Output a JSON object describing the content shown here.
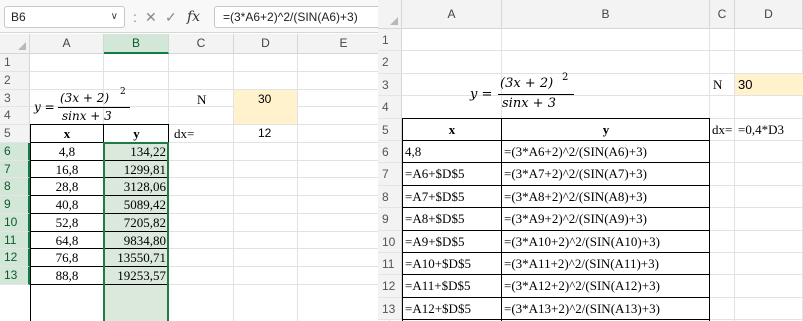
{
  "left": {
    "name_box": "B6",
    "name_box_chevron": "chevron-down-icon",
    "formula_icons": {
      "colon": ":",
      "cancel": "✕",
      "enter": "✓",
      "fx": "fx"
    },
    "formula": "=(3*A6+2)^2/(SIN(A6)+3)",
    "columns": [
      "A",
      "B",
      "C",
      "D",
      "E"
    ],
    "rows": [
      "1",
      "2",
      "3",
      "4",
      "5",
      "6",
      "7",
      "8",
      "9",
      "10",
      "11",
      "12",
      "13"
    ],
    "equation": {
      "lhs": "y =",
      "numerator": "(3x + 2)",
      "exponent": "2",
      "denominator": "sinx + 3"
    },
    "n_label": "N",
    "n_value": "30",
    "header_x": "x",
    "header_y": "y",
    "dx_label": "dx=",
    "dx_value": "12",
    "x_values": [
      "4,8",
      "16,8",
      "28,8",
      "40,8",
      "52,8",
      "64,8",
      "76,8",
      "88,8"
    ],
    "y_values": [
      "134,22",
      "1299,81",
      "3128,06",
      "5089,42",
      "7205,82",
      "9834,80",
      "13550,71",
      "19253,57"
    ]
  },
  "right": {
    "columns": [
      "A",
      "B",
      "C",
      "D"
    ],
    "rows": [
      "1",
      "2",
      "3",
      "4",
      "5",
      "6",
      "7",
      "8",
      "9",
      "10",
      "11",
      "12",
      "13"
    ],
    "equation": {
      "lhs": "y =",
      "numerator": "(3x + 2)",
      "exponent": "2",
      "denominator": "sinx + 3"
    },
    "n_label": "N",
    "n_value": "30",
    "header_x": "x",
    "header_y": "y",
    "dx_label": "dx=",
    "dx_formula": "=0,4*D3",
    "x_formulas": [
      "4,8",
      "=A6+$D$5",
      "=A7+$D$5",
      "=A8+$D$5",
      "=A9+$D$5",
      "=A10+$D$5",
      "=A11+$D$5",
      "=A12+$D$5"
    ],
    "y_formulas": [
      "=(3*A6+2)^2/(SIN(A6)+3)",
      "=(3*A7+2)^2/(SIN(A7)+3)",
      "=(3*A8+2)^2/(SIN(A8)+3)",
      "=(3*A9+2)^2/(SIN(A9)+3)",
      "=(3*A10+2)^2/(SIN(A10)+3)",
      "=(3*A11+2)^2/(SIN(A11)+3)",
      "=(3*A12+2)^2/(SIN(A12)+3)",
      "=(3*A13+2)^2/(SIN(A13)+3)"
    ]
  },
  "colors": {
    "accent": "#107c41",
    "selection": "#dbe9dd",
    "input_fill": "#fff2cc"
  }
}
